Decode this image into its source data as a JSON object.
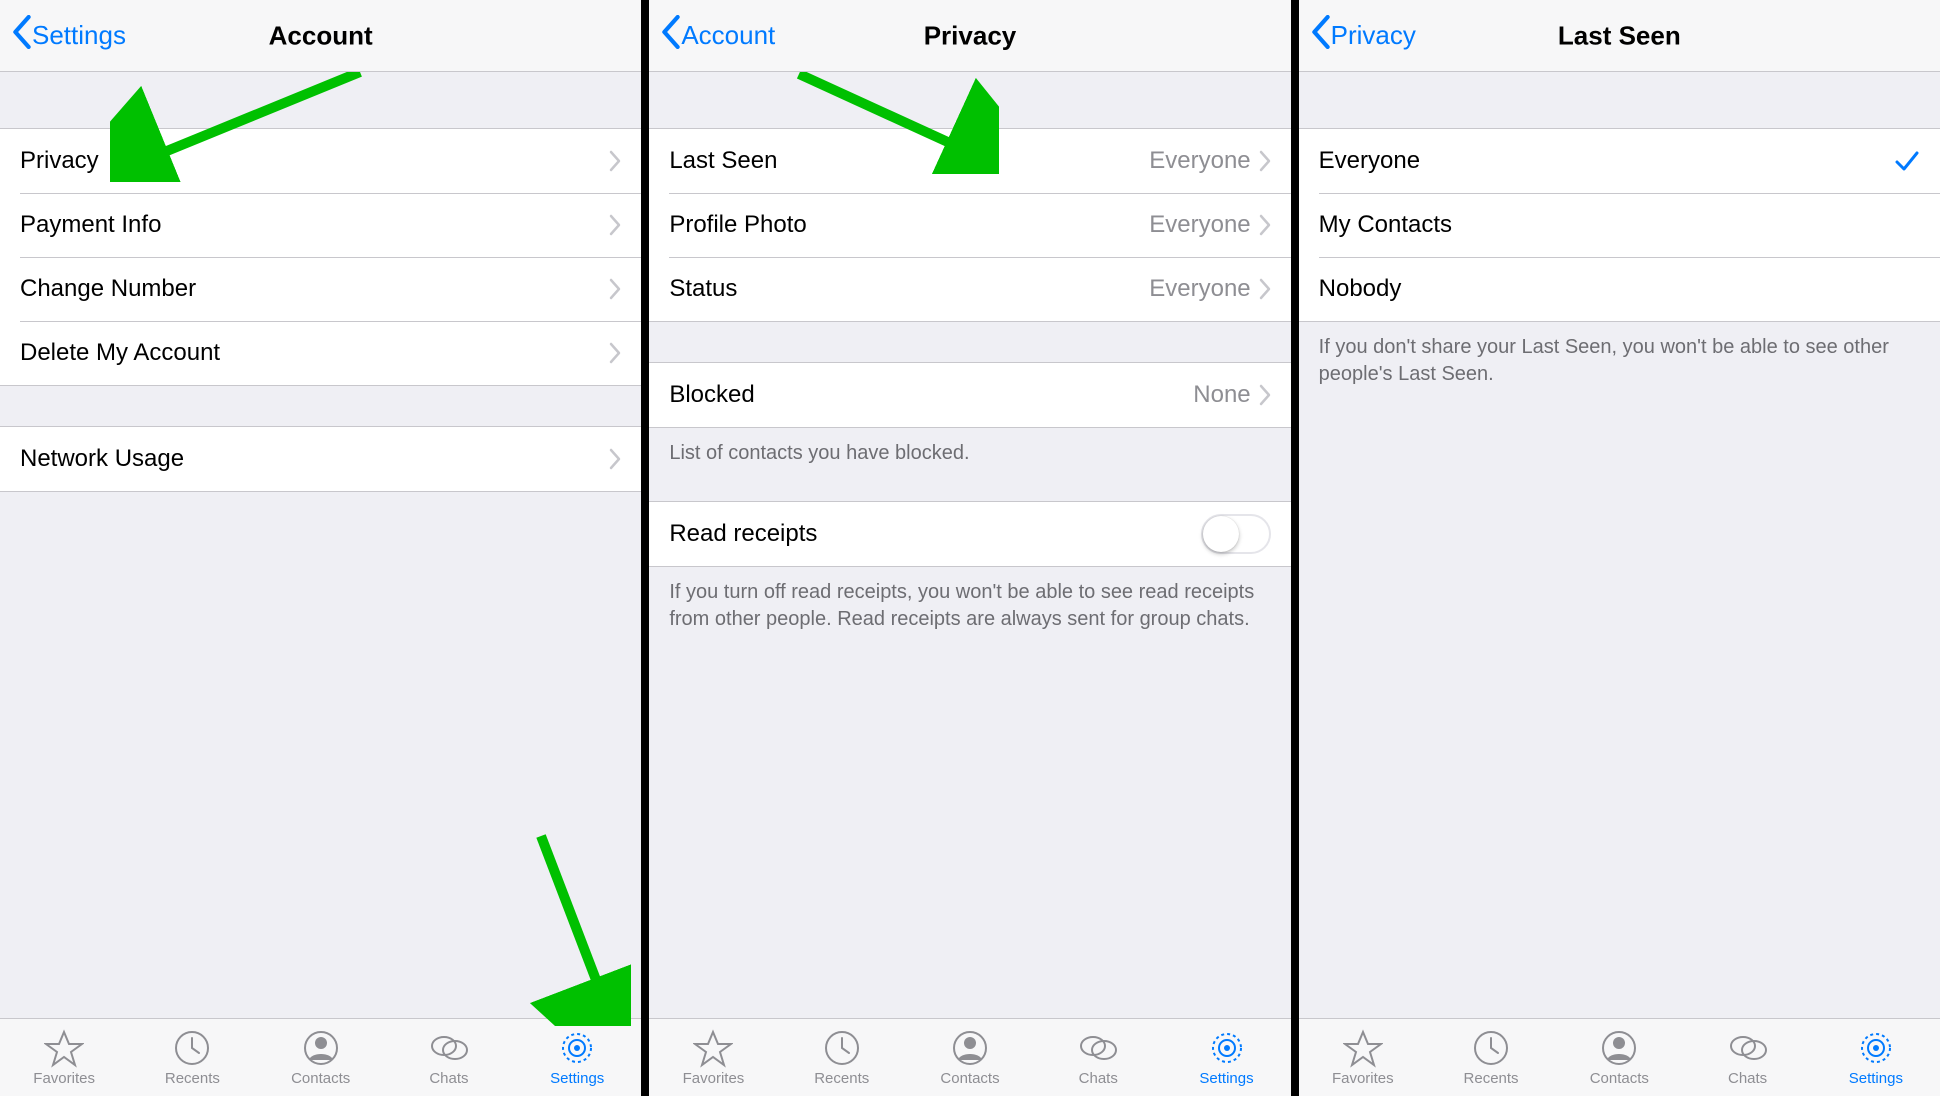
{
  "colors": {
    "tint": "#007aff",
    "arrow": "#00c000"
  },
  "tabs": {
    "favorites": "Favorites",
    "recents": "Recents",
    "contacts": "Contacts",
    "chats": "Chats",
    "settings": "Settings"
  },
  "screen1": {
    "back": "Settings",
    "title": "Account",
    "group1": [
      {
        "label": "Privacy"
      },
      {
        "label": "Payment Info"
      },
      {
        "label": "Change Number"
      },
      {
        "label": "Delete My Account"
      }
    ],
    "group2": [
      {
        "label": "Network Usage"
      }
    ]
  },
  "screen2": {
    "back": "Account",
    "title": "Privacy",
    "group1": [
      {
        "label": "Last Seen",
        "value": "Everyone"
      },
      {
        "label": "Profile Photo",
        "value": "Everyone"
      },
      {
        "label": "Status",
        "value": "Everyone"
      }
    ],
    "blocked": {
      "label": "Blocked",
      "value": "None"
    },
    "blocked_note": "List of contacts you have blocked.",
    "read_receipts": {
      "label": "Read receipts",
      "on": false
    },
    "read_note": "If you turn off read receipts, you won't be able to see read receipts from other people. Read receipts are always sent for group chats."
  },
  "screen3": {
    "back": "Privacy",
    "title": "Last Seen",
    "options": [
      {
        "label": "Everyone",
        "selected": true
      },
      {
        "label": "My Contacts",
        "selected": false
      },
      {
        "label": "Nobody",
        "selected": false
      }
    ],
    "note": "If you don't share your Last Seen, you won't be able to see other people's Last Seen."
  }
}
